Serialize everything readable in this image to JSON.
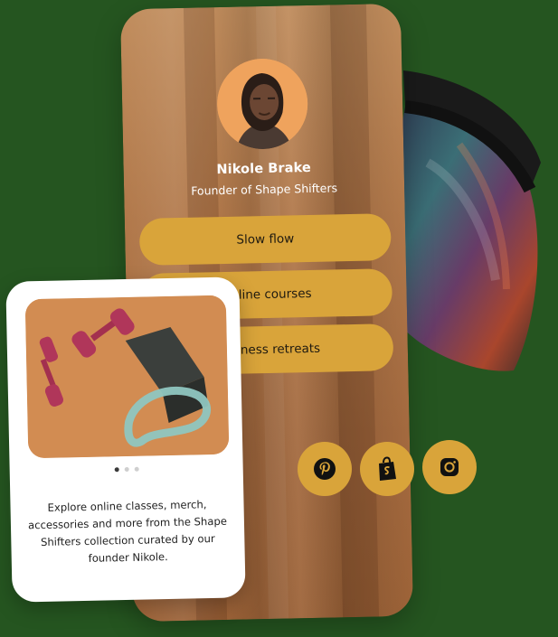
{
  "profile": {
    "name": "Nikole Brake",
    "role": "Founder of Shape Shifters",
    "avatar_icon": "profile-photo"
  },
  "links": [
    {
      "label": "Slow flow"
    },
    {
      "label": "Online courses"
    },
    {
      "label": "Wellness retreats"
    }
  ],
  "social": [
    {
      "icon": "pinterest-icon"
    },
    {
      "icon": "shopify-icon"
    },
    {
      "icon": "instagram-icon"
    }
  ],
  "product_card": {
    "description": "Explore online classes, merch, accessories and more from the Shape Shifters collection curated by our founder Nikole.",
    "carousel_dots": 3,
    "active_dot": 0
  },
  "colors": {
    "background": "#255520",
    "button": "#d9a43a",
    "card": "#ffffff",
    "avatar_bg": "#efa35d"
  }
}
